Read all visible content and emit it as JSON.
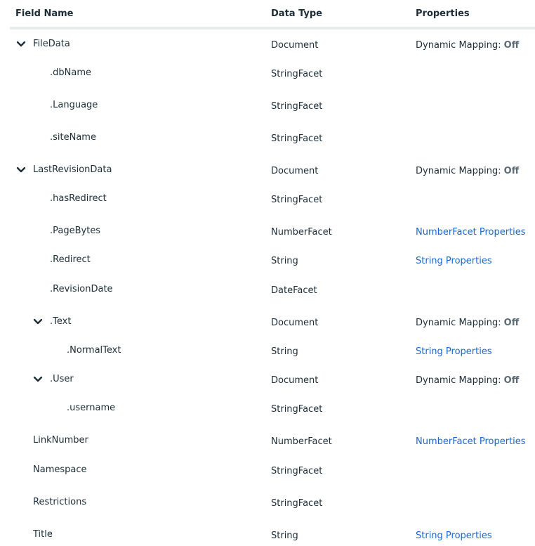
{
  "header": {
    "field_name": "Field Name",
    "data_type": "Data Type",
    "properties": "Properties"
  },
  "rows": [
    {
      "name": "FileData",
      "type": "Document",
      "dyn_label": "Dynamic Mapping:",
      "dyn_value": "Off",
      "expandable": true
    },
    {
      "name": ".dbName",
      "type": "StringFacet"
    },
    {
      "name": ".Language",
      "type": "StringFacet"
    },
    {
      "name": ".siteName",
      "type": "StringFacet"
    },
    {
      "name": "LastRevisionData",
      "type": "Document",
      "dyn_label": "Dynamic Mapping:",
      "dyn_value": "Off",
      "expandable": true
    },
    {
      "name": ".hasRedirect",
      "type": "StringFacet"
    },
    {
      "name": ".PageBytes",
      "type": "NumberFacet",
      "link": "NumberFacet Properties"
    },
    {
      "name": ".Redirect",
      "type": "String",
      "link": "String Properties"
    },
    {
      "name": ".RevisionDate",
      "type": "DateFacet"
    },
    {
      "name": ".Text",
      "type": "Document",
      "dyn_label": "Dynamic Mapping:",
      "dyn_value": "Off",
      "expandable": true
    },
    {
      "name": ".NormalText",
      "type": "String",
      "link": "String Properties"
    },
    {
      "name": ".User",
      "type": "Document",
      "dyn_label": "Dynamic Mapping:",
      "dyn_value": "Off",
      "expandable": true
    },
    {
      "name": ".username",
      "type": "StringFacet"
    },
    {
      "name": "LinkNumber",
      "type": "NumberFacet",
      "link": "NumberFacet Properties"
    },
    {
      "name": "Namespace",
      "type": "StringFacet"
    },
    {
      "name": "Restrictions",
      "type": "StringFacet"
    },
    {
      "name": "Title",
      "type": "String",
      "link": "String Properties"
    }
  ],
  "icons": {
    "expand": "chevron-down-icon"
  }
}
